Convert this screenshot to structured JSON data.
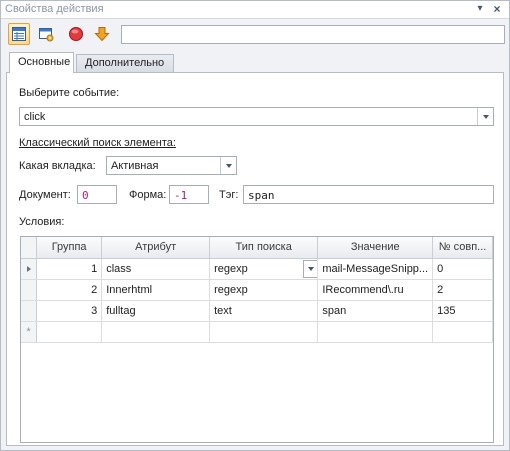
{
  "window": {
    "title": "Свойства действия"
  },
  "toolbar": {
    "name_value": ""
  },
  "tabs": [
    {
      "label": "Основные",
      "active": true
    },
    {
      "label": "Дополнительно",
      "active": false
    }
  ],
  "event": {
    "label": "Выберите событие:",
    "value": "click"
  },
  "classic_search": {
    "heading": "Классический поиск элемента:"
  },
  "tab_select": {
    "label": "Какая вкладка:",
    "value": "Активная"
  },
  "document": {
    "label": "Документ:",
    "value": "0"
  },
  "form": {
    "label": "Форма:",
    "value": "-1"
  },
  "tag": {
    "label": "Тэг:",
    "value": "span"
  },
  "conditions": {
    "label": "Условия:",
    "columns": [
      "Группа",
      "Атрибут",
      "Тип поиска",
      "Значение",
      "№ совп..."
    ],
    "rows": [
      {
        "group": "1",
        "attribute": "class",
        "search_type": "regexp",
        "value": "mail-MessageSnipp...",
        "match": "0"
      },
      {
        "group": "2",
        "attribute": "Innerhtml",
        "search_type": "regexp",
        "value": "IRecommend\\.ru",
        "match": "2"
      },
      {
        "group": "3",
        "attribute": "fulltag",
        "search_type": "text",
        "value": "span",
        "match": "135"
      }
    ],
    "new_row_marker": "*"
  }
}
